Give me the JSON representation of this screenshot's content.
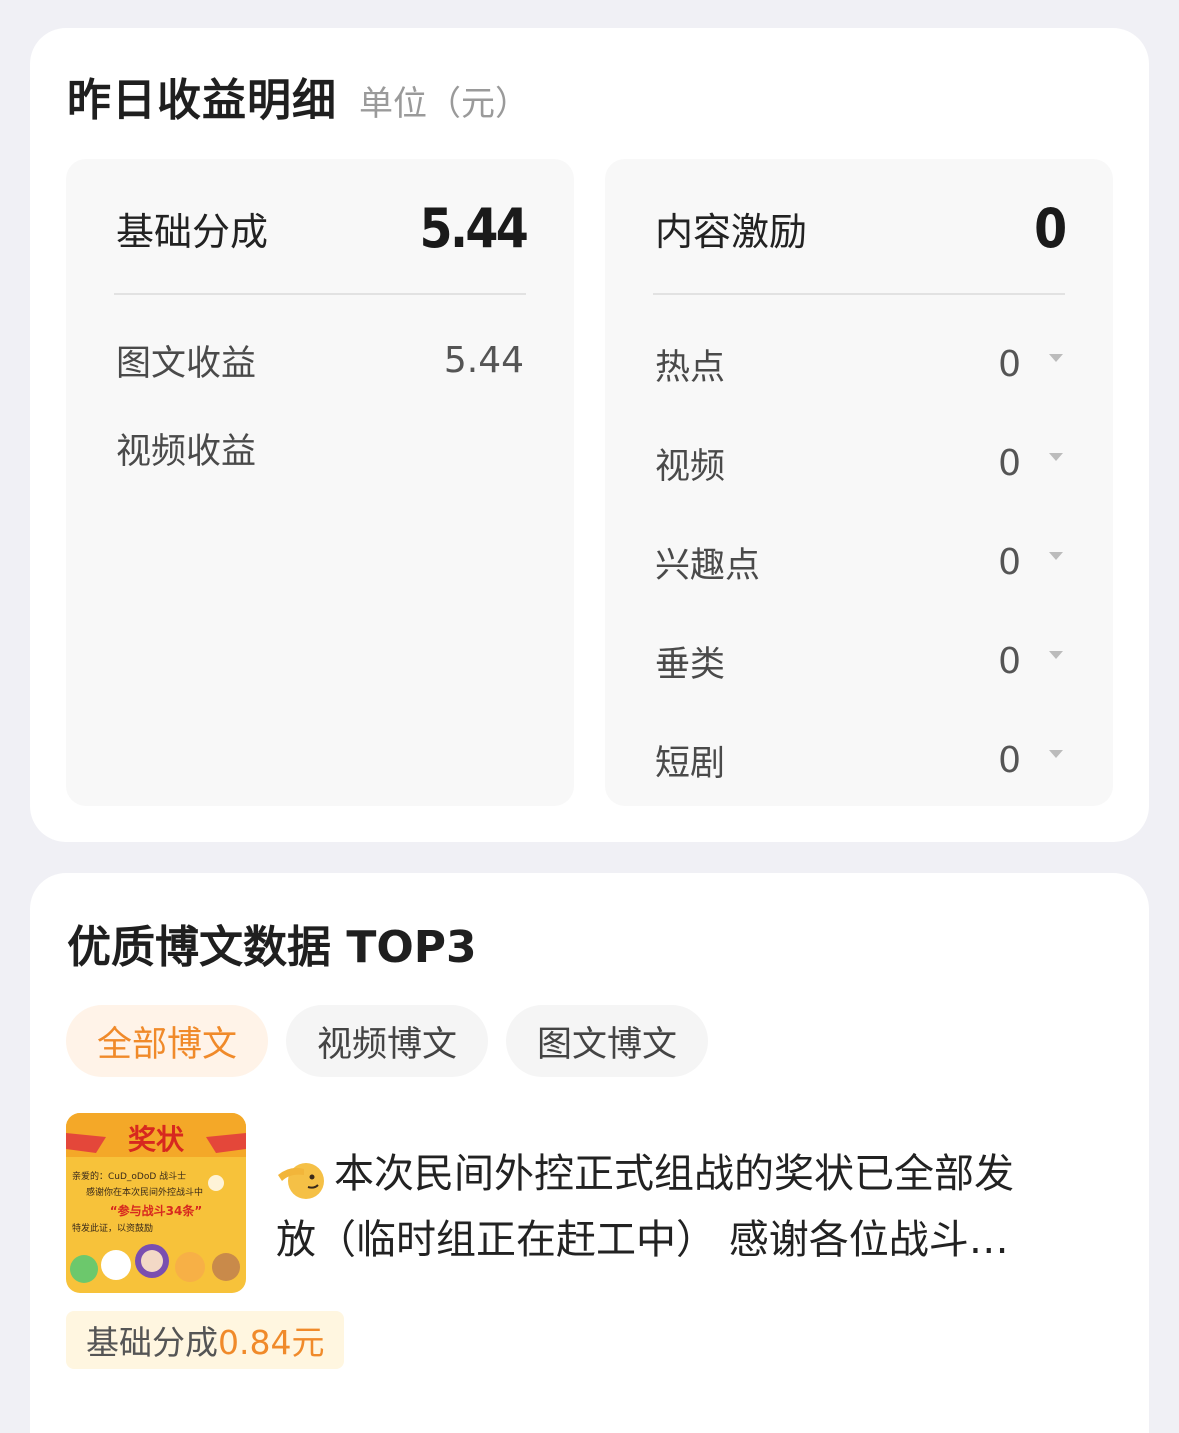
{
  "earnings": {
    "title": "昨日收益明细",
    "unit": "单位（元）",
    "base": {
      "label": "基础分成",
      "value": "5.44",
      "rows": [
        {
          "label": "图文收益",
          "value": "5.44"
        },
        {
          "label": "视频收益",
          "value": ""
        }
      ]
    },
    "incentive": {
      "label": "内容激励",
      "value": "0",
      "rows": [
        {
          "label": "热点",
          "value": "0"
        },
        {
          "label": "视频",
          "value": "0"
        },
        {
          "label": "兴趣点",
          "value": "0"
        },
        {
          "label": "垂类",
          "value": "0"
        },
        {
          "label": "短剧",
          "value": "0"
        }
      ]
    }
  },
  "top3": {
    "title": "优质博文数据 TOP3",
    "tabs": [
      {
        "label": "全部博文",
        "active": true
      },
      {
        "label": "视频博文",
        "active": false
      },
      {
        "label": "图文博文",
        "active": false
      }
    ],
    "post": {
      "thumb_title": "奖状",
      "thumb_line1": "亲爱的：CuD_oDoD 战斗士",
      "thumb_line2": "感谢你在本次民间外控战斗中",
      "thumb_line3": "“参与战斗34条”",
      "thumb_line4": "特发此证，以资鼓励",
      "text_line1": "本次民间外控正式组战的奖状已全部发",
      "text_line2": "放（临时组正在赶工中） 感谢各位战斗…",
      "earn_label": "基础分成",
      "earn_value": "0.84元"
    }
  },
  "colors": {
    "accent": "#f08a2a",
    "tag_bg": "#fff6e0",
    "tab_active_bg": "#fff3e8",
    "page_bg": "#f0f0f5"
  }
}
